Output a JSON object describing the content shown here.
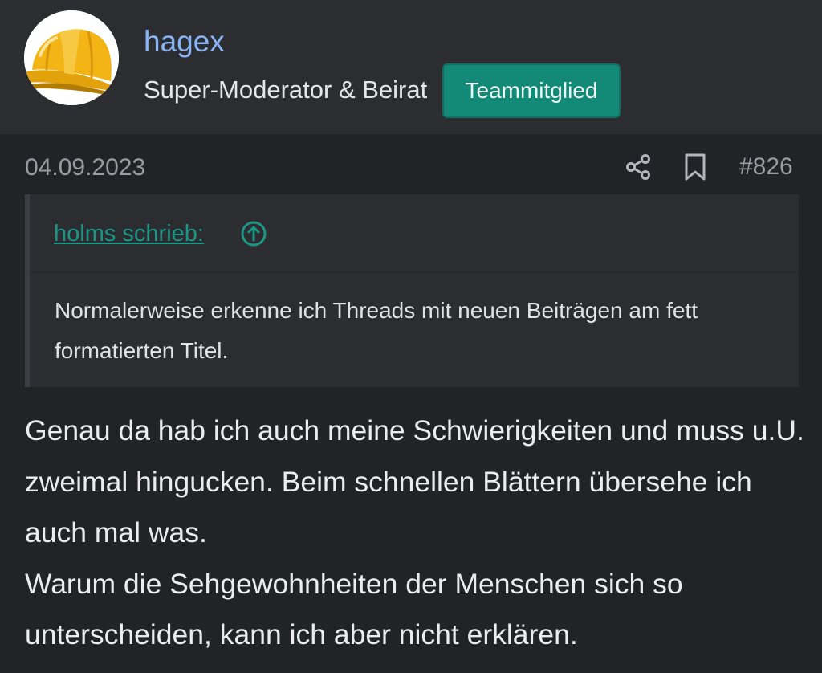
{
  "user": {
    "name": "hagex",
    "title": "Super-Moderator & Beirat",
    "badge": "Teammitglied",
    "avatar_icon": "hard-hat-icon"
  },
  "post": {
    "date": "04.09.2023",
    "number": "#826",
    "actions": {
      "share_icon": "share-icon",
      "bookmark_icon": "bookmark-icon"
    },
    "quote": {
      "author_label": "holms schrieb:",
      "jump_icon": "arrow-up-circle-icon",
      "text": "Normalerweise erkenne ich Threads mit neuen Beiträgen am fett formatierten Titel."
    },
    "paragraphs": [
      "Genau da hab ich auch meine Schwierigkeiten und muss u.U. zweimal hingucken. Beim schnellen Blättern übersehe ich auch mal was.",
      "Warum die Sehgewohnheiten der Menschen sich so unterscheiden, kann ich aber nicht erklären."
    ]
  },
  "colors": {
    "background": "#222326",
    "header_background": "#2c2d31",
    "username": "#8ab4f8",
    "badge": "#138a78",
    "quote_link": "#1d9585",
    "meta_text": "#9a9ca1"
  }
}
